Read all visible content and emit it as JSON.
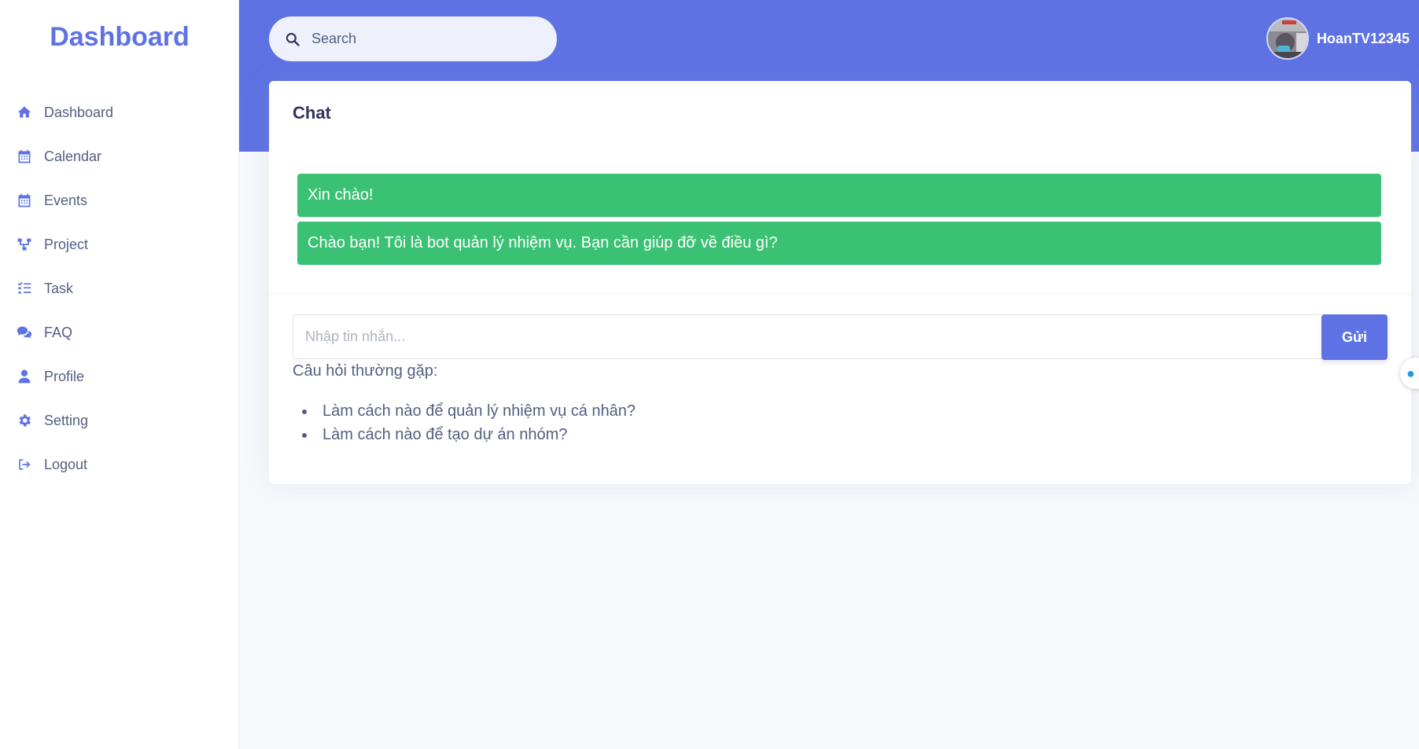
{
  "sidebar": {
    "brand": "Dashboard",
    "items": [
      {
        "label": "Dashboard",
        "icon": "home-icon"
      },
      {
        "label": "Calendar",
        "icon": "calendar-icon"
      },
      {
        "label": "Events",
        "icon": "calendar-icon"
      },
      {
        "label": "Project",
        "icon": "sitemap-icon"
      },
      {
        "label": "Task",
        "icon": "tasks-icon"
      },
      {
        "label": "FAQ",
        "icon": "comments-icon"
      },
      {
        "label": "Profile",
        "icon": "user-icon"
      },
      {
        "label": "Setting",
        "icon": "gear-icon"
      },
      {
        "label": "Logout",
        "icon": "sign-out-icon"
      }
    ]
  },
  "header": {
    "search_placeholder": "Search",
    "username": "HoanTV12345"
  },
  "chat": {
    "title": "Chat",
    "messages": [
      "Xin chào!",
      "Chào bạn! Tôi là bot quản lý nhiệm vụ. Bạn cần giúp đỡ về điều gì?"
    ],
    "input_placeholder": "Nhập tin nhắn...",
    "send_label": "Gửi",
    "faq_heading": "Câu hỏi thường gặp:",
    "faq_items": [
      "Làm cách nào để quản lý nhiệm vụ cá nhân?",
      "Làm cách nào để tạo dự án nhóm?"
    ]
  },
  "colors": {
    "primary": "#5e72e4",
    "message_bg": "#3bc174"
  }
}
